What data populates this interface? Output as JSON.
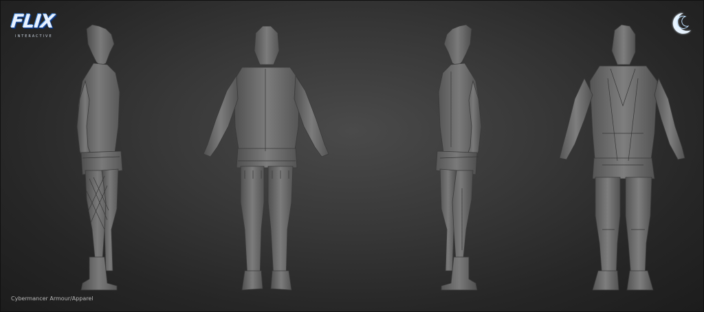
{
  "logo": {
    "wordmark": "FLIX",
    "subtitle": "INTERACTIVE"
  },
  "badge": {
    "icon": "crescent-moon-icon"
  },
  "figures": [
    {
      "view": "side-left-view"
    },
    {
      "view": "back-view"
    },
    {
      "view": "side-right-view"
    },
    {
      "view": "front-three-quarter-view"
    }
  ],
  "caption": "Cybermancer Armour/Apparel",
  "colors": {
    "background": "#383838",
    "model_gray": "#6b6b6b",
    "logo_blue": "#2a6fd0",
    "moon_white": "#e8f4ff"
  }
}
